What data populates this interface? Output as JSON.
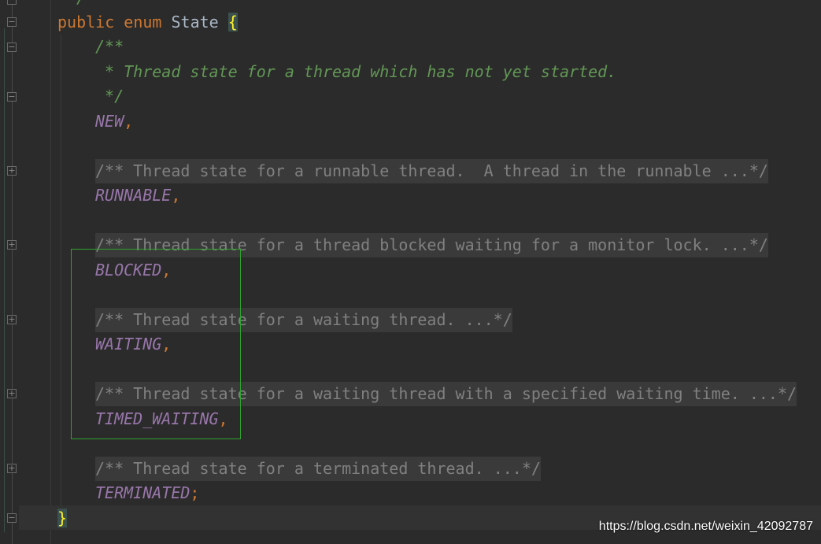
{
  "editor": {
    "header": {
      "keywords": "public enum",
      "name": "State",
      "open_brace": "{"
    },
    "doc_comment": [
      "/**",
      " * Thread state for a thread which has not yet started.",
      " */"
    ],
    "constants": [
      {
        "name": "NEW",
        "punct": ",",
        "folded_comment": ""
      },
      {
        "name": "RUNNABLE",
        "punct": ",",
        "folded_comment": "/** Thread state for a runnable thread.  A thread in the runnable ...*/"
      },
      {
        "name": "BLOCKED",
        "punct": ",",
        "folded_comment": "/** Thread state for a thread blocked waiting for a monitor lock. ...*/"
      },
      {
        "name": "WAITING",
        "punct": ",",
        "folded_comment": "/** Thread state for a waiting thread. ...*/"
      },
      {
        "name": "TIMED_WAITING",
        "punct": ",",
        "folded_comment": "/** Thread state for a waiting thread with a specified waiting time. ...*/"
      },
      {
        "name": "TERMINATED",
        "punct": ";",
        "folded_comment": "/** Thread state for a terminated thread. ...*/"
      }
    ],
    "close_brace": "}",
    "top_partial": "*/"
  },
  "watermark": "https://blog.csdn.net/weixin_42092787",
  "colors": {
    "background": "#2b2b2b",
    "keyword": "#cc7832",
    "doc_comment": "#629755",
    "constant": "#9876aa",
    "folded": "#808080",
    "selection_box": "#2fa32f"
  }
}
